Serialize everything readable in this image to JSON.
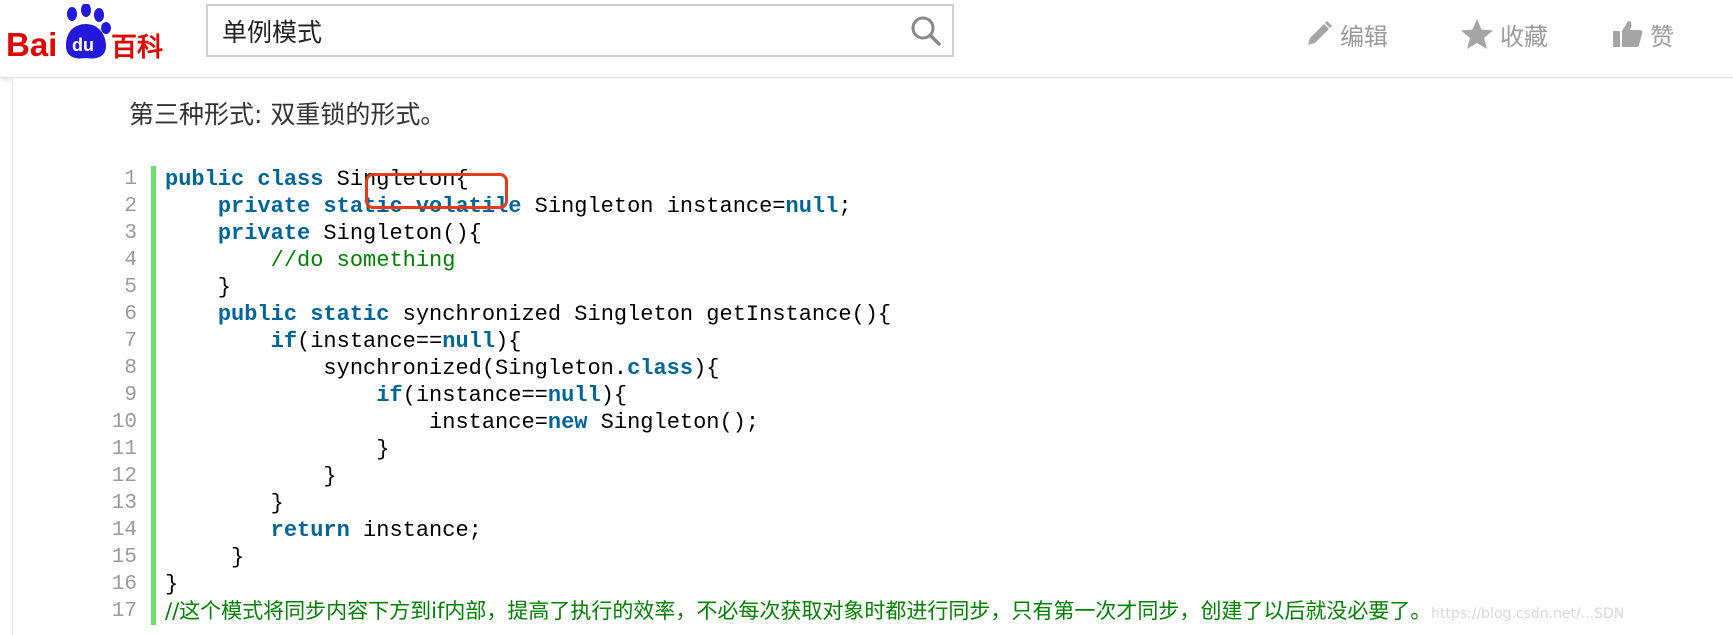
{
  "header": {
    "logo_text": "Bai du 百科",
    "search": {
      "value": "单例模式",
      "placeholder": ""
    },
    "actions": [
      {
        "label": "编辑",
        "icon": "pencil-icon"
      },
      {
        "label": "收藏",
        "icon": "star-icon"
      },
      {
        "label": "赞",
        "icon": "thumbs-up-icon"
      }
    ]
  },
  "content": {
    "intro": "第三种形式: 双重锁的形式。",
    "code_lines": [
      {
        "n": "1",
        "segs": [
          [
            "kw",
            "public class"
          ],
          [
            "t",
            " Singleton{"
          ]
        ]
      },
      {
        "n": "2",
        "segs": [
          [
            "t",
            "    "
          ],
          [
            "kw",
            "private static volatile"
          ],
          [
            "t",
            " Singleton instance="
          ],
          [
            "kw",
            "null"
          ],
          [
            "t",
            ";"
          ]
        ]
      },
      {
        "n": "3",
        "segs": [
          [
            "t",
            "    "
          ],
          [
            "kw",
            "private"
          ],
          [
            "t",
            " Singleton(){"
          ]
        ]
      },
      {
        "n": "4",
        "segs": [
          [
            "t",
            "        "
          ],
          [
            "cm",
            "//do something"
          ]
        ]
      },
      {
        "n": "5",
        "segs": [
          [
            "t",
            "    }"
          ]
        ]
      },
      {
        "n": "6",
        "segs": [
          [
            "t",
            "    "
          ],
          [
            "kw",
            "public static"
          ],
          [
            "t",
            " synchronized Singleton getInstance(){"
          ]
        ]
      },
      {
        "n": "7",
        "segs": [
          [
            "t",
            "        "
          ],
          [
            "kw",
            "if"
          ],
          [
            "t",
            "(instance=="
          ],
          [
            "kw",
            "null"
          ],
          [
            "t",
            "){"
          ]
        ]
      },
      {
        "n": "8",
        "segs": [
          [
            "t",
            "            synchronized(Singleton."
          ],
          [
            "kw",
            "class"
          ],
          [
            "t",
            "){"
          ]
        ]
      },
      {
        "n": "9",
        "segs": [
          [
            "t",
            "                "
          ],
          [
            "kw",
            "if"
          ],
          [
            "t",
            "(instance=="
          ],
          [
            "kw",
            "null"
          ],
          [
            "t",
            "){"
          ]
        ]
      },
      {
        "n": "10",
        "segs": [
          [
            "t",
            "                    instance="
          ],
          [
            "kw",
            "new"
          ],
          [
            "t",
            " Singleton();"
          ]
        ]
      },
      {
        "n": "11",
        "segs": [
          [
            "t",
            "                }"
          ]
        ]
      },
      {
        "n": "12",
        "segs": [
          [
            "t",
            "            }"
          ]
        ]
      },
      {
        "n": "13",
        "segs": [
          [
            "t",
            "        }"
          ]
        ]
      },
      {
        "n": "14",
        "segs": [
          [
            "t",
            "        "
          ],
          [
            "kw",
            "return"
          ],
          [
            "t",
            " instance;"
          ]
        ]
      },
      {
        "n": "15",
        "segs": [
          [
            "t",
            "     }"
          ]
        ]
      },
      {
        "n": "16",
        "segs": [
          [
            "t",
            "}"
          ]
        ]
      },
      {
        "n": "17",
        "segs": [
          [
            "cmcn",
            "//这个模式将同步内容下方到if内部，提高了执行的效率，不必每次获取对象时都进行同步，只有第一次才同步，创建了以后就没必要了。"
          ]
        ]
      }
    ],
    "highlighted_keyword": "volatile",
    "watermark": "https://blog.csdn.net/...SDN"
  },
  "colors": {
    "keyword": "#006699",
    "comment": "#008200",
    "gutter_bar": "#6ce26c",
    "highlight_box": "#e63a1d",
    "logo_red": "#e10601",
    "logo_blue": "#2319dc"
  }
}
